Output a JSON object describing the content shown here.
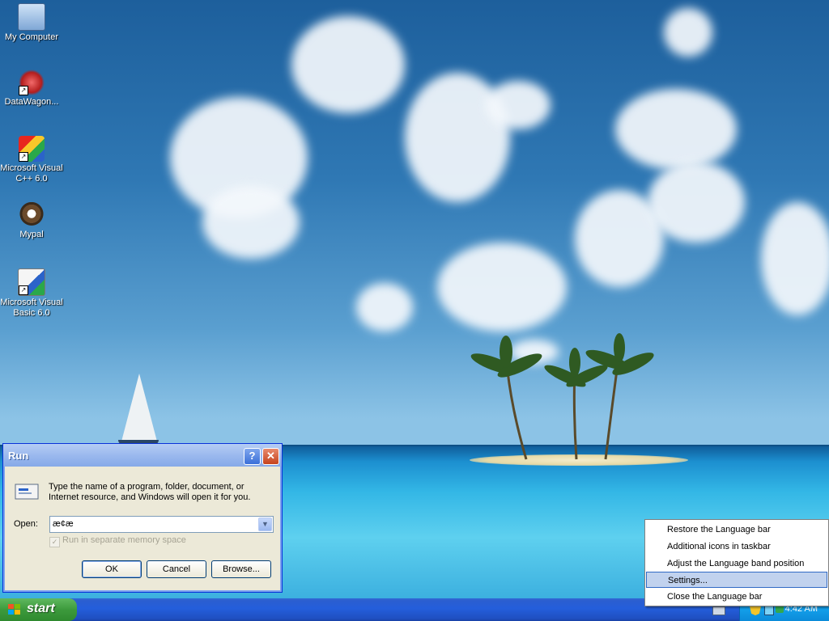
{
  "desktop": {
    "icons": [
      {
        "label": "My Computer",
        "icon": "computer-icon"
      },
      {
        "label": "DataWagon...",
        "icon": "datawagon-icon"
      },
      {
        "label": "Microsoft Visual C++ 6.0",
        "icon": "visual-cpp-icon"
      },
      {
        "label": "Mypal",
        "icon": "mypal-icon"
      },
      {
        "label": "Microsoft Visual Basic 6.0",
        "icon": "visual-basic-icon"
      }
    ]
  },
  "run_dialog": {
    "title": "Run",
    "help_glyph": "?",
    "close_glyph": "✕",
    "description": "Type the name of a program, folder, document, or Internet resource, and Windows will open it for you.",
    "open_label": "Open:",
    "open_value": "æ¢æ",
    "checkbox_label": "Run in separate memory space",
    "checkbox_checked": true,
    "buttons": {
      "ok": "OK",
      "cancel": "Cancel",
      "browse": "Browse..."
    }
  },
  "taskbar": {
    "start_label": "start",
    "clock": "4:42 AM"
  },
  "context_menu": {
    "items": [
      {
        "label": "Restore the Language bar",
        "selected": false
      },
      {
        "label": "Additional icons in taskbar",
        "selected": false
      },
      {
        "label": "Adjust the Language band position",
        "selected": false
      },
      {
        "label": "Settings...",
        "selected": true
      },
      {
        "label": "Close the Language bar",
        "selected": false
      }
    ]
  },
  "colors": {
    "taskbar_blue": "#245edb",
    "start_green": "#3c9a3c",
    "tray_blue": "#0c9ae8",
    "menu_highlight": "#c1d2ee"
  }
}
